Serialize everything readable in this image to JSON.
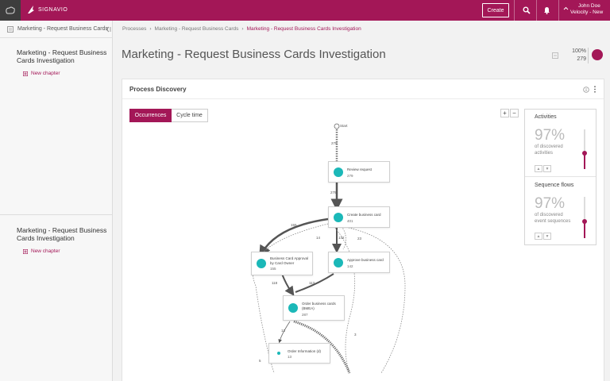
{
  "brand": {
    "name": "SIGNAVIO",
    "accent": "#a31757",
    "teal": "#1bb8b8"
  },
  "topbar": {
    "create_label": "Create",
    "user_name": "John Doe",
    "workspace": "Velocity - New"
  },
  "sidebar": {
    "header_title": "Marketing - Request Business Cards",
    "sections": [
      {
        "title": "Marketing - Request Business Cards Investigation",
        "new_chapter": "New chapter"
      },
      {
        "title": "Marketing - Request Business Cards Investigation",
        "new_chapter": "New chapter"
      }
    ]
  },
  "breadcrumb": {
    "items": [
      "Processes",
      "Marketing - Request Business Cards",
      "Marketing - Request Business Cards Investigation"
    ]
  },
  "page": {
    "title": "Marketing - Request Business Cards Investigation",
    "percent": "100%",
    "count": "279"
  },
  "card": {
    "title": "Process Discovery",
    "tabs": [
      "Occurrences",
      "Cycle time"
    ],
    "active_tab": 0
  },
  "diagram": {
    "start_label": "Start",
    "activities": [
      {
        "name": "Review request",
        "count": "279"
      },
      {
        "name": "Create business card",
        "count": "401"
      },
      {
        "name": "Business Card Approval by Card Owner",
        "count": "155"
      },
      {
        "name": "Approve business card",
        "count": "142"
      },
      {
        "name": "Order business cards (BMEA)",
        "count": "287"
      },
      {
        "name": "Order Information (d)",
        "count": "13"
      }
    ],
    "flow_labels": [
      "279",
      "279",
      "155",
      "14",
      "142",
      "23",
      "118",
      "113",
      "13",
      "3",
      "5"
    ]
  },
  "panel": {
    "activities_title": "Activities",
    "activities_pct": "97%",
    "activities_desc": "of discovered activities",
    "activities_level": 0.97,
    "flows_title": "Sequence flows",
    "flows_pct": "97%",
    "flows_desc": "of discovered event sequences",
    "flows_level": 0.97
  }
}
